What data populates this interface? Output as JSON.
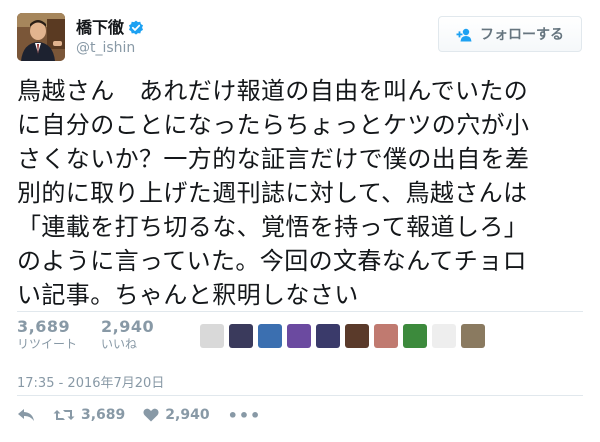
{
  "user": {
    "display_name": "橋下徹",
    "screen_name": "@t_ishin",
    "verified": true,
    "avatar_icon": "profile-photo"
  },
  "follow_button": {
    "label": "フォローする",
    "icon": "add-user-icon"
  },
  "tweet": {
    "text": "鳥越さん　あれだけ報道の自由を叫んでいたの\nに自分のことになったらちょっとケツの穴が小\nさくないか？一方的な証言だけで僕の出自を差\n別的に取り上げた週刊誌に対して、鳥越さんは\n「連載を打ち切るな、覚悟を持って報道しろ」\nのように言っていた。今回の文春なんてチョロ\nい記事。ちゃんと釈明しなさい"
  },
  "stats": {
    "retweets": {
      "count": "3,689",
      "label": "リツイート"
    },
    "likes": {
      "count": "2,940",
      "label": "いいね"
    }
  },
  "liker_avatars": [
    {
      "icon": "user-avatar-1",
      "color": "#d9d9d9"
    },
    {
      "icon": "user-avatar-2",
      "color": "#3a3a5c"
    },
    {
      "icon": "user-avatar-3",
      "color": "#3b6fb0"
    },
    {
      "icon": "user-avatar-4",
      "color": "#6b4aa0"
    },
    {
      "icon": "user-avatar-5",
      "color": "#3a3a6a"
    },
    {
      "icon": "user-avatar-6",
      "color": "#5a3a2a"
    },
    {
      "icon": "user-avatar-7",
      "color": "#c07a70"
    },
    {
      "icon": "user-avatar-8",
      "color": "#3c8a3c"
    },
    {
      "icon": "user-avatar-9",
      "color": "#eeeeee"
    },
    {
      "icon": "user-avatar-10",
      "color": "#8a7a60"
    }
  ],
  "timestamp": "17:35 - 2016年7月20日",
  "actions": {
    "reply_icon": "reply-icon",
    "retweet_icon": "retweet-icon",
    "retweet_count": "3,689",
    "like_icon": "heart-icon",
    "like_count": "2,940",
    "more_icon": "more-icon",
    "more_label": "•••"
  },
  "colors": {
    "text": "#14171a",
    "muted": "#8899a6",
    "divider": "#e1e8ed",
    "verified": "#1da1f2",
    "follow_icon": "#1da1f2"
  }
}
